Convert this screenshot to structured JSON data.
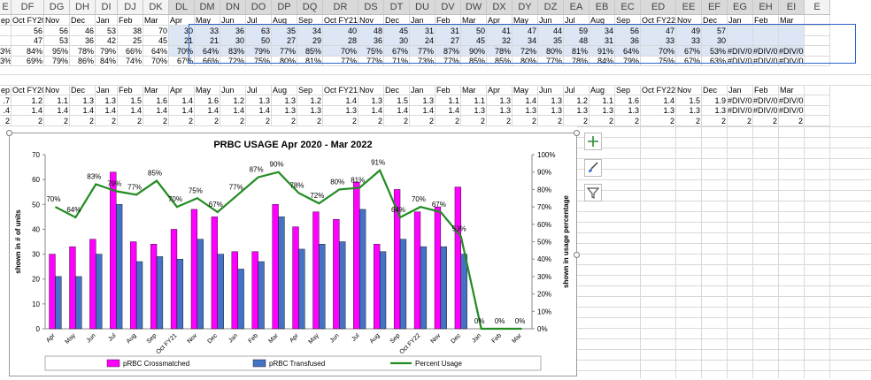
{
  "columns": [
    "E",
    "DF",
    "DG",
    "DH",
    "DI",
    "DJ",
    "DK",
    "DL",
    "DM",
    "DN",
    "DO",
    "DP",
    "DQ",
    "DR",
    "DS",
    "DT",
    "DU",
    "DV",
    "DW",
    "DX",
    "DY",
    "DZ",
    "EA",
    "EB",
    "EC",
    "ED",
    "EE",
    "EF",
    "EG",
    "EH",
    "EI",
    "E"
  ],
  "top_rows": [
    [
      "ep",
      "Oct FY20",
      "Nov",
      "Dec",
      "Jan",
      "Feb",
      "Mar",
      "Apr",
      "May",
      "Jun",
      "Jul",
      "Aug",
      "Sep",
      "Oct FY21",
      "Nov",
      "Dec",
      "Jan",
      "Feb",
      "Mar",
      "Apr",
      "May",
      "Jun",
      "Jul",
      "Aug",
      "Sep",
      "Oct FY22",
      "Nov",
      "Dec",
      "Jan",
      "Feb",
      "Mar",
      ""
    ],
    [
      "",
      "56",
      "56",
      "46",
      "53",
      "38",
      "70",
      "30",
      "33",
      "36",
      "63",
      "35",
      "34",
      "40",
      "48",
      "45",
      "31",
      "31",
      "50",
      "41",
      "47",
      "44",
      "59",
      "34",
      "56",
      "47",
      "49",
      "57",
      "",
      "",
      "",
      ""
    ],
    [
      "",
      "47",
      "53",
      "36",
      "42",
      "25",
      "45",
      "21",
      "21",
      "30",
      "50",
      "27",
      "29",
      "28",
      "36",
      "30",
      "24",
      "27",
      "45",
      "32",
      "34",
      "35",
      "48",
      "31",
      "36",
      "33",
      "33",
      "30",
      "",
      "",
      "",
      ""
    ],
    [
      "3%",
      "84%",
      "95%",
      "78%",
      "79%",
      "66%",
      "64%",
      "70%",
      "64%",
      "83%",
      "79%",
      "77%",
      "85%",
      "70%",
      "75%",
      "67%",
      "77%",
      "87%",
      "90%",
      "78%",
      "72%",
      "80%",
      "81%",
      "91%",
      "64%",
      "70%",
      "67%",
      "53%",
      "#DIV/0!",
      "#DIV/0!",
      "#DIV/0!",
      ""
    ],
    [
      "3%",
      "69%",
      "79%",
      "86%",
      "84%",
      "74%",
      "70%",
      "67%",
      "66%",
      "72%",
      "75%",
      "80%",
      "81%",
      "77%",
      "77%",
      "71%",
      "73%",
      "77%",
      "85%",
      "85%",
      "80%",
      "77%",
      "78%",
      "84%",
      "79%",
      "75%",
      "67%",
      "63%",
      "#DIV/0!",
      "#DIV/0!",
      "#DIV/0!",
      ""
    ]
  ],
  "bottom_rows": [
    [
      "ep",
      "Oct FY20",
      "Nov",
      "Dec",
      "Jan",
      "Feb",
      "Mar",
      "Apr",
      "May",
      "Jun",
      "Jul",
      "Aug",
      "Sep",
      "Oct FY21",
      "Nov",
      "Dec",
      "Jan",
      "Feb",
      "Mar",
      "Apr",
      "May",
      "Jun",
      "Jul",
      "Aug",
      "Sep",
      "Oct FY22",
      "Nov",
      "Dec",
      "Jan",
      "Feb",
      "Mar",
      ""
    ],
    [
      ".7",
      "1.2",
      "1.1",
      "1.3",
      "1.3",
      "1.5",
      "1.6",
      "1.4",
      "1.6",
      "1.2",
      "1.3",
      "1.3",
      "1.2",
      "1.4",
      "1.3",
      "1.5",
      "1.3",
      "1.1",
      "1.1",
      "1.3",
      "1.4",
      "1.3",
      "1.2",
      "1.1",
      "1.6",
      "1.4",
      "1.5",
      "1.9",
      "#DIV/0!",
      "#DIV/0!",
      "#DIV/0!",
      ""
    ],
    [
      ".4",
      "1.4",
      "1.4",
      "1.4",
      "1.4",
      "1.4",
      "1.4",
      "1.4",
      "1.4",
      "1.4",
      "1.4",
      "1.3",
      "1.3",
      "1.3",
      "1.4",
      "1.4",
      "1.4",
      "1.4",
      "1.3",
      "1.3",
      "1.3",
      "1.3",
      "1.3",
      "1.3",
      "1.3",
      "1.3",
      "1.3",
      "1.3",
      "#DIV/0!",
      "#DIV/0!",
      "#DIV/0!",
      ""
    ],
    [
      "2",
      "2",
      "2",
      "2",
      "2",
      "2",
      "2",
      "2",
      "2",
      "2",
      "2",
      "2",
      "2",
      "2",
      "2",
      "2",
      "2",
      "2",
      "2",
      "2",
      "2",
      "2",
      "2",
      "2",
      "2",
      "2",
      "2",
      "2",
      "2",
      "2",
      "2",
      ""
    ]
  ],
  "side_buttons": {
    "add": "chart-elements-icon",
    "style": "chart-styles-icon",
    "filter": "chart-filters-icon"
  },
  "chart_data": {
    "type": "bar",
    "title": "PRBC USAGE Apr 2020 - Mar 2022",
    "ylabel": "shown in # of units",
    "y2label": "shown in usage percentage",
    "ylim": [
      0,
      70
    ],
    "y2lim": [
      0,
      100
    ],
    "yticks": [
      "0",
      "10",
      "20",
      "30",
      "40",
      "50",
      "60",
      "70"
    ],
    "y2ticks": [
      "0%",
      "10%",
      "20%",
      "30%",
      "40%",
      "50%",
      "60%",
      "70%",
      "80%",
      "90%",
      "100%"
    ],
    "categories": [
      "Apr",
      "May",
      "Jun",
      "Jul",
      "Aug",
      "Sep",
      "Oct FY21",
      "Nov",
      "Dec",
      "Jan",
      "Feb",
      "Mar",
      "Apr",
      "May",
      "Jun",
      "Jul",
      "Aug",
      "Sep",
      "Oct FY22",
      "Nov",
      "Dec",
      "Jan",
      "Feb",
      "Mar"
    ],
    "series": [
      {
        "name": "pRBC Crossmatched",
        "color": "#ff00ff",
        "values": [
          30,
          33,
          36,
          63,
          35,
          34,
          40,
          48,
          45,
          31,
          31,
          50,
          41,
          47,
          44,
          59,
          34,
          56,
          47,
          49,
          57,
          0,
          0,
          0
        ]
      },
      {
        "name": "pRBC Transfused",
        "color": "#4472c4",
        "values": [
          21,
          21,
          30,
          50,
          27,
          29,
          28,
          36,
          30,
          24,
          27,
          45,
          32,
          34,
          35,
          48,
          31,
          36,
          33,
          33,
          30,
          0,
          0,
          0
        ]
      },
      {
        "name": "Percent Usage",
        "color": "#228b22",
        "axis": "right",
        "values": [
          70,
          64,
          83,
          79,
          77,
          85,
          70,
          75,
          67,
          77,
          87,
          90,
          78,
          72,
          80,
          81,
          91,
          64,
          70,
          67,
          53,
          0,
          0,
          0
        ],
        "labels": [
          "70%",
          "64%",
          "83%",
          "79%",
          "77%",
          "85%",
          "70%",
          "75%",
          "67%",
          "77%",
          "87%",
          "90%",
          "78%",
          "72%",
          "80%",
          "81%",
          "91%",
          "64%",
          "70%",
          "67%",
          "53%",
          "0%",
          "0%",
          "0%"
        ]
      }
    ],
    "legend": "bottom"
  }
}
